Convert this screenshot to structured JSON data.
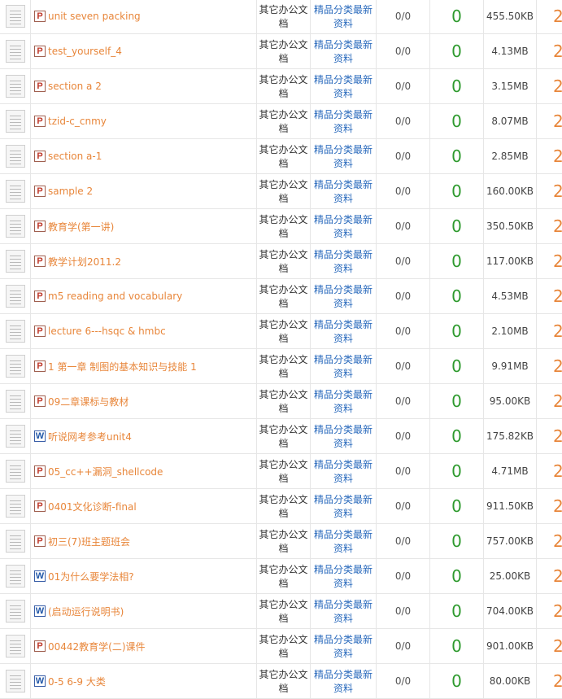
{
  "rows": [
    {
      "type": "P",
      "name": "unit seven packing",
      "cat1": "其它办公文档",
      "cat2": "精品分类最新资料",
      "ratio": "0/0",
      "count": "0",
      "size": "455.50KB",
      "last": "2"
    },
    {
      "type": "P",
      "name": "test_yourself_4",
      "cat1": "其它办公文档",
      "cat2": "精品分类最新资料",
      "ratio": "0/0",
      "count": "0",
      "size": "4.13MB",
      "last": "2"
    },
    {
      "type": "P",
      "name": "section a 2",
      "cat1": "其它办公文档",
      "cat2": "精品分类最新资料",
      "ratio": "0/0",
      "count": "0",
      "size": "3.15MB",
      "last": "2"
    },
    {
      "type": "P",
      "name": "tzid-c_cnmy",
      "cat1": "其它办公文档",
      "cat2": "精品分类最新资料",
      "ratio": "0/0",
      "count": "0",
      "size": "8.07MB",
      "last": "2"
    },
    {
      "type": "P",
      "name": "section a-1",
      "cat1": "其它办公文档",
      "cat2": "精品分类最新资料",
      "ratio": "0/0",
      "count": "0",
      "size": "2.85MB",
      "last": "2"
    },
    {
      "type": "P",
      "name": "sample 2",
      "cat1": "其它办公文档",
      "cat2": "精品分类最新资料",
      "ratio": "0/0",
      "count": "0",
      "size": "160.00KB",
      "last": "2"
    },
    {
      "type": "P",
      "name": "教育学(第一讲)",
      "cat1": "其它办公文档",
      "cat2": "精品分类最新资料",
      "ratio": "0/0",
      "count": "0",
      "size": "350.50KB",
      "last": "2"
    },
    {
      "type": "P",
      "name": "教学计划2011.2",
      "cat1": "其它办公文档",
      "cat2": "精品分类最新资料",
      "ratio": "0/0",
      "count": "0",
      "size": "117.00KB",
      "last": "2"
    },
    {
      "type": "P",
      "name": "m5 reading and vocabulary",
      "cat1": "其它办公文档",
      "cat2": "精品分类最新资料",
      "ratio": "0/0",
      "count": "0",
      "size": "4.53MB",
      "last": "2"
    },
    {
      "type": "P",
      "name": "lecture 6---hsqc & hmbc",
      "cat1": "其它办公文档",
      "cat2": "精品分类最新资料",
      "ratio": "0/0",
      "count": "0",
      "size": "2.10MB",
      "last": "2"
    },
    {
      "type": "P",
      "name": "1 第一章 制图的基本知识与技能 1",
      "cat1": "其它办公文档",
      "cat2": "精品分类最新资料",
      "ratio": "0/0",
      "count": "0",
      "size": "9.91MB",
      "last": "2"
    },
    {
      "type": "P",
      "name": "09二章课标与教材",
      "cat1": "其它办公文档",
      "cat2": "精品分类最新资料",
      "ratio": "0/0",
      "count": "0",
      "size": "95.00KB",
      "last": "2"
    },
    {
      "type": "W",
      "name": "听说网考参考unit4",
      "cat1": "其它办公文档",
      "cat2": "精品分类最新资料",
      "ratio": "0/0",
      "count": "0",
      "size": "175.82KB",
      "last": "2"
    },
    {
      "type": "P",
      "name": "05_cc++漏洞_shellcode",
      "cat1": "其它办公文档",
      "cat2": "精品分类最新资料",
      "ratio": "0/0",
      "count": "0",
      "size": "4.71MB",
      "last": "2"
    },
    {
      "type": "P",
      "name": "0401文化诊断-final",
      "cat1": "其它办公文档",
      "cat2": "精品分类最新资料",
      "ratio": "0/0",
      "count": "0",
      "size": "911.50KB",
      "last": "2"
    },
    {
      "type": "P",
      "name": "初三(7)班主题班会",
      "cat1": "其它办公文档",
      "cat2": "精品分类最新资料",
      "ratio": "0/0",
      "count": "0",
      "size": "757.00KB",
      "last": "2"
    },
    {
      "type": "W",
      "name": "01为什么要学法相?",
      "cat1": "其它办公文档",
      "cat2": "精品分类最新资料",
      "ratio": "0/0",
      "count": "0",
      "size": "25.00KB",
      "last": "2"
    },
    {
      "type": "W",
      "name": "(启动运行说明书)",
      "cat1": "其它办公文档",
      "cat2": "精品分类最新资料",
      "ratio": "0/0",
      "count": "0",
      "size": "704.00KB",
      "last": "2"
    },
    {
      "type": "P",
      "name": "00442教育学(二)课件",
      "cat1": "其它办公文档",
      "cat2": "精品分类最新资料",
      "ratio": "0/0",
      "count": "0",
      "size": "901.00KB",
      "last": "2"
    },
    {
      "type": "W",
      "name": "0-5 6-9 大类",
      "cat1": "其它办公文档",
      "cat2": "精品分类最新资料",
      "ratio": "0/0",
      "count": "0",
      "size": "80.00KB",
      "last": "2"
    }
  ],
  "colors": {
    "file_link": "#e8863a",
    "category_link": "#2b6bbd",
    "count_green": "#2e9a2e",
    "ppt_badge": "#c0392b",
    "word_badge": "#1f56a8"
  },
  "icons": {
    "thumbnail": "document-thumbnail-icon",
    "P": "powerpoint-file-icon",
    "W": "word-file-icon"
  }
}
